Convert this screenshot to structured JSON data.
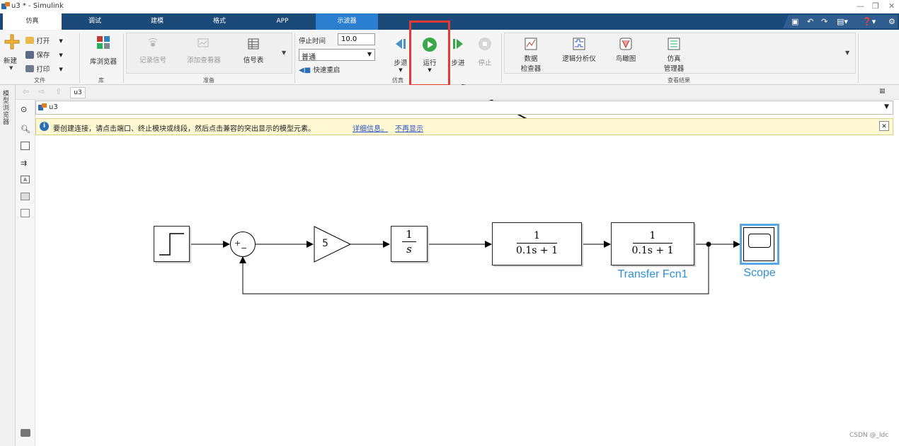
{
  "window": {
    "title": "u3 * - Simulink"
  },
  "tabs": [
    {
      "label": "仿真",
      "active": true
    },
    {
      "label": "调试"
    },
    {
      "label": "建模"
    },
    {
      "label": "格式"
    },
    {
      "label": "APP"
    },
    {
      "label": "示波器",
      "scope": true
    }
  ],
  "ribbon": {
    "file": {
      "new_label": "新建",
      "open_label": "打开",
      "save_label": "保存",
      "print_label": "打印",
      "section": "文件"
    },
    "library": {
      "browser_label": "库浏览器",
      "section": "库"
    },
    "prepare": {
      "log_signal_label": "记录信号",
      "add_viewer_label": "添加查看器",
      "signal_table_label": "信号表",
      "section": "准备"
    },
    "sim_settings": {
      "stop_time_label": "停止时间",
      "stop_time_value": "10.0",
      "mode_value": "普通",
      "fast_restart_label": "快速重启"
    },
    "simulate": {
      "step_back_label": "步退",
      "run_label": "运行",
      "step_forward_label": "步进",
      "stop_label": "停止",
      "section": "仿真"
    },
    "review": {
      "data_inspector_line1": "数据",
      "data_inspector_line2": "检查器",
      "logic_analyzer_label": "逻辑分析仪",
      "birdseye_label": "鸟瞰图",
      "sim_manager_line1": "仿真",
      "sim_manager_line2": "管理器",
      "section": "查看结果"
    }
  },
  "left_panel": {
    "model_browser_label": "模型浏览器"
  },
  "nav": {
    "tab_label": "u3"
  },
  "path": {
    "model_name": "u3"
  },
  "infobar": {
    "message": "要创建连接，请点击端口、终止模块或线段，然后点击兼容的突出显示的模型元素。",
    "details_link": "详细信息。",
    "dismiss_link": "不再显示"
  },
  "diagram": {
    "sum_plus": "+",
    "sum_minus": "−",
    "gain_value": "5",
    "integrator_num": "1",
    "integrator_den": "s",
    "tf_num": "1",
    "tf_den": "0.1s + 1",
    "tf1_num": "1",
    "tf1_den": "0.1s + 1",
    "tf1_name": "Transfer Fcn1",
    "scope_name": "Scope"
  },
  "watermark": "CSDN @_ldc",
  "colors": {
    "tab_bar": "#1b4a79",
    "scope_tab": "#2a7fd0",
    "highlight": "#e53935",
    "block_label": "#2f8fd6",
    "link": "#2a55c8"
  }
}
